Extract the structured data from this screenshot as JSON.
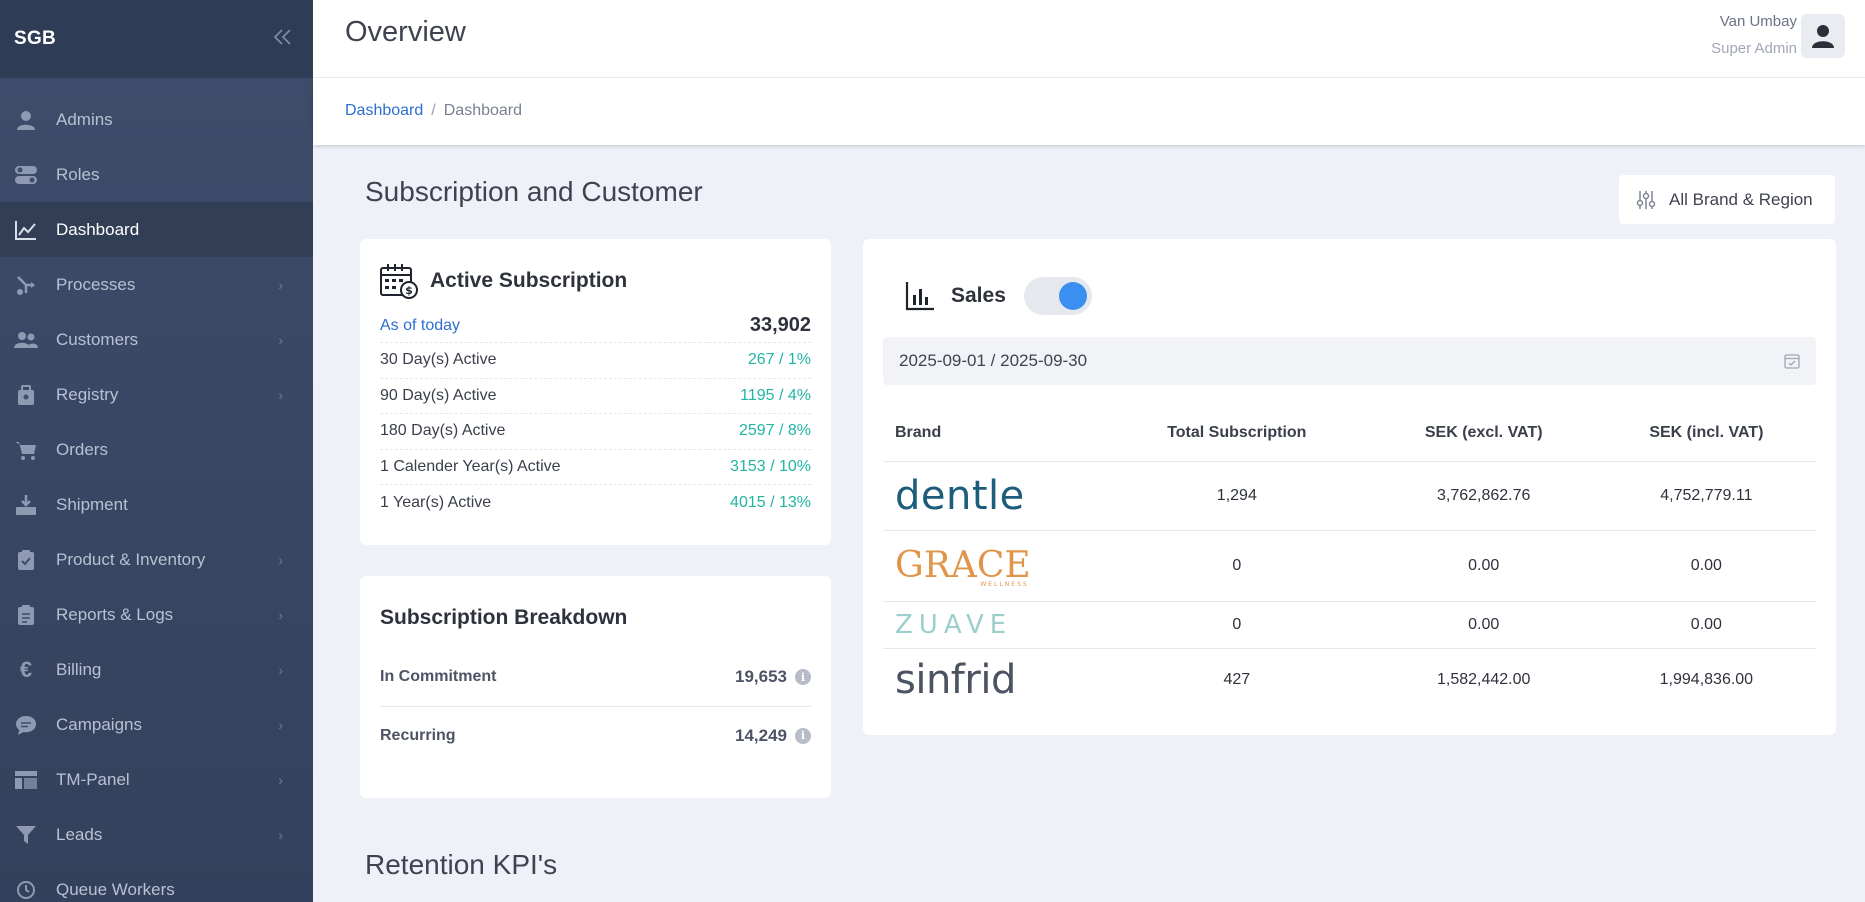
{
  "sidebar": {
    "brand": "SGB",
    "items": [
      {
        "label": "Admins",
        "icon": "user-icon",
        "chevron": false
      },
      {
        "label": "Roles",
        "icon": "toggle-icon",
        "chevron": false
      },
      {
        "label": "Dashboard",
        "icon": "chart-line-icon",
        "chevron": false,
        "active": true
      },
      {
        "label": "Processes",
        "icon": "process-icon",
        "chevron": true
      },
      {
        "label": "Customers",
        "icon": "users-icon",
        "chevron": true
      },
      {
        "label": "Registry",
        "icon": "registry-icon",
        "chevron": true
      },
      {
        "label": "Orders",
        "icon": "cart-icon",
        "chevron": false
      },
      {
        "label": "Shipment",
        "icon": "shipment-icon",
        "chevron": false
      },
      {
        "label": "Product & Inventory",
        "icon": "clipboard-check-icon",
        "chevron": true
      },
      {
        "label": "Reports & Logs",
        "icon": "clipboard-list-icon",
        "chevron": true
      },
      {
        "label": "Billing",
        "icon": "euro-icon",
        "chevron": true
      },
      {
        "label": "Campaigns",
        "icon": "chat-icon",
        "chevron": true
      },
      {
        "label": "TM-Panel",
        "icon": "panel-icon",
        "chevron": true
      },
      {
        "label": "Leads",
        "icon": "filter-icon",
        "chevron": true
      },
      {
        "label": "Queue Workers",
        "icon": "history-icon",
        "chevron": false
      }
    ]
  },
  "header": {
    "title": "Overview",
    "user_name": "Van Umbay",
    "user_role": "Super Admin"
  },
  "breadcrumb": {
    "link": "Dashboard",
    "separator": "/",
    "current": "Dashboard"
  },
  "main": {
    "section_title": "Subscription and Customer",
    "filter_label": "All Brand & Region",
    "retention_title": "Retention KPI's"
  },
  "active_subscription": {
    "title": "Active Subscription",
    "as_of_label": "As of today",
    "as_of_value": "33,902",
    "rows": [
      {
        "label": "30 Day(s) Active",
        "value": "267 / 1%"
      },
      {
        "label": "90 Day(s) Active",
        "value": "1195 / 4%"
      },
      {
        "label": "180 Day(s) Active",
        "value": "2597 / 8%"
      },
      {
        "label": "1 Calender Year(s) Active",
        "value": "3153 / 10%"
      },
      {
        "label": "1 Year(s) Active",
        "value": "4015 / 13%"
      }
    ]
  },
  "breakdown": {
    "title": "Subscription Breakdown",
    "rows": [
      {
        "label": "In Commitment",
        "value": "19,653"
      },
      {
        "label": "Recurring",
        "value": "14,249"
      }
    ]
  },
  "sales": {
    "title": "Sales",
    "toggle_on": true,
    "date_range": "2025-09-01 / 2025-09-30",
    "columns": [
      "Brand",
      "Total Subscription",
      "SEK (excl. VAT)",
      "SEK (incl. VAT)"
    ],
    "rows": [
      {
        "brand": "dentle",
        "total": "1,294",
        "excl": "3,762,862.76",
        "incl": "4,752,779.11"
      },
      {
        "brand": "GRACE",
        "brand_sub": "WELLNESS",
        "total": "0",
        "excl": "0.00",
        "incl": "0.00"
      },
      {
        "brand": "ZUAVE",
        "total": "0",
        "excl": "0.00",
        "incl": "0.00"
      },
      {
        "brand": "sinfrid",
        "total": "427",
        "excl": "1,582,442.00",
        "incl": "1,994,836.00"
      }
    ]
  },
  "colors": {
    "accent": "#3b8ff0",
    "link": "#2d6fd0",
    "positive": "#22b5a5",
    "sidebar": "#3d4d6b"
  }
}
